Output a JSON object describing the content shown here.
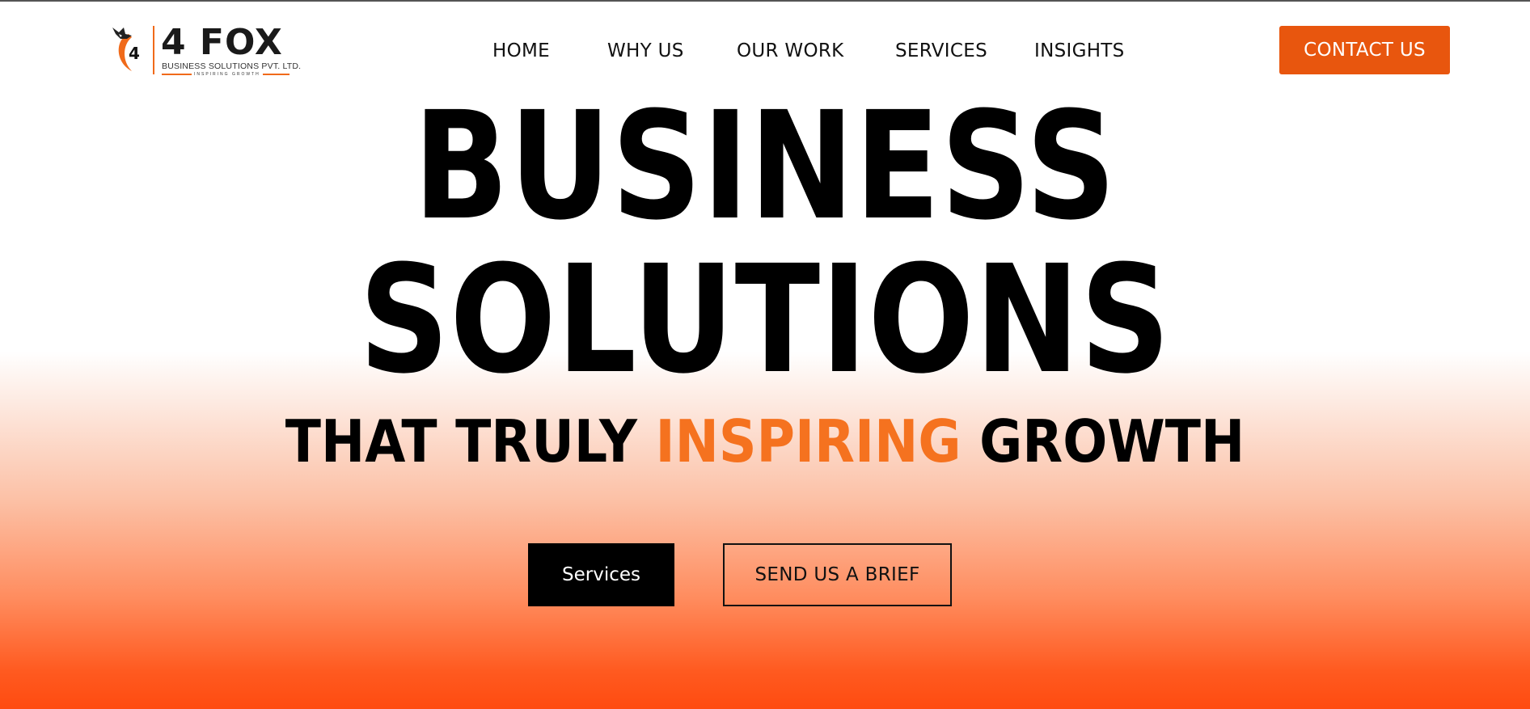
{
  "logo": {
    "brand": "4 FOX",
    "subtitle": "BUSINESS SOLUTIONS PVT. LTD.",
    "tagline": "INSPIRING GROWTH",
    "mark_number": "4",
    "accent_color": "#f06a1a"
  },
  "nav": {
    "items": [
      {
        "label": "HOME"
      },
      {
        "label": "WHY US"
      },
      {
        "label": "OUR WORK"
      },
      {
        "label": "SERVICES"
      },
      {
        "label": "INSIGHTS"
      }
    ],
    "contact_label": "CONTACT US"
  },
  "hero": {
    "line1": "BUSINESS",
    "line2": "SOLUTIONS",
    "line3_prefix": "THAT TRULY ",
    "line3_accent": "INSPIRING",
    "line3_suffix": " GROWTH"
  },
  "cta": {
    "primary_label": "Services",
    "secondary_label": "SEND US A BRIEF"
  },
  "colors": {
    "brand_orange": "#e8560e",
    "accent_text": "#f5721f",
    "gradient_bottom": "#ff4b10"
  }
}
